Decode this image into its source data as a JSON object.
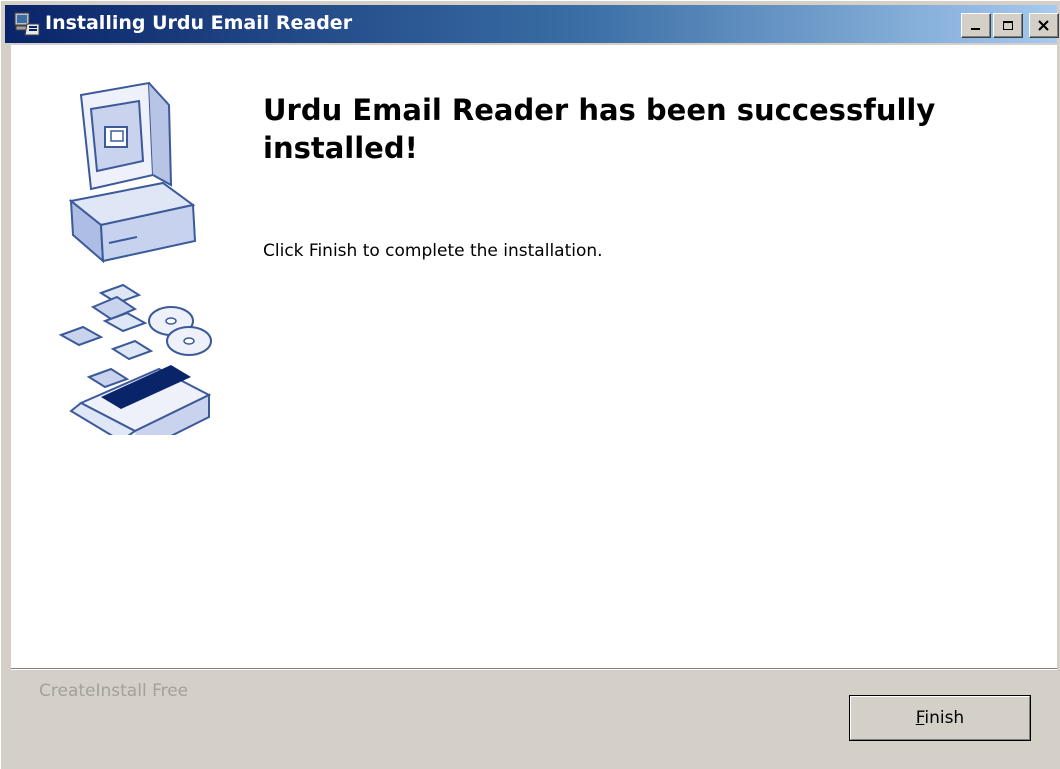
{
  "window": {
    "title": "Installing Urdu Email Reader",
    "icon": "installer-icon",
    "controls": {
      "minimize": "minimize-icon",
      "maximize": "maximize-icon",
      "close": "close-icon"
    }
  },
  "main": {
    "illustration": "installer-computer-disks-box-illustration",
    "headline": "Urdu Email Reader has been successfully installed!",
    "instruction": "Click Finish to complete the installation."
  },
  "footer": {
    "brand": "CreateInstall Free",
    "finish_label": "Finish"
  },
  "colors": {
    "title_gradient_start": "#0a246a",
    "title_gradient_end": "#a6caf0",
    "face": "#d4d0c8",
    "illustration_blue": "#0a246a"
  }
}
